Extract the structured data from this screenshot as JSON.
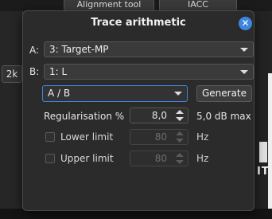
{
  "background": {
    "tabs": [
      "Alignment tool",
      "IACC"
    ],
    "button_2k": "2k",
    "logo_text": "ITH"
  },
  "dialog": {
    "title": "Trace arithmetic",
    "close_icon": "close-icon",
    "a_label": "A:",
    "a_value": "3: Target-MP",
    "b_label": "B:",
    "b_value": "1: L",
    "operation_value": "A / B",
    "generate_label": "Generate",
    "regularisation": {
      "label": "Regularisation %",
      "value": "8,0",
      "hint": "5,0 dB max"
    },
    "lower_limit": {
      "label": "Lower limit",
      "checked": false,
      "value": "80",
      "unit": "Hz"
    },
    "upper_limit": {
      "label": "Upper limit",
      "checked": false,
      "value": "80",
      "unit": "Hz"
    }
  },
  "colors": {
    "accent": "#3d86e0",
    "dialog_bg": "#2b2b2b",
    "field_bg": "#3a3a3a"
  }
}
